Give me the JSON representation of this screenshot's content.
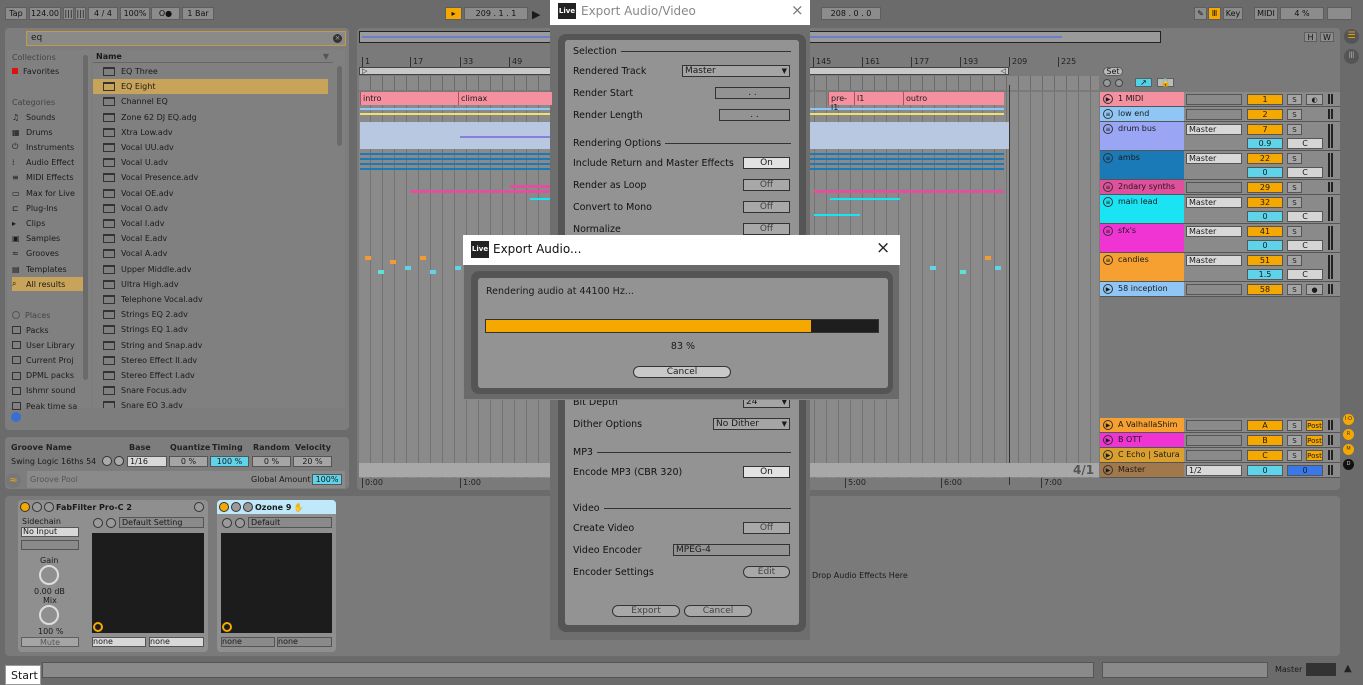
{
  "transport": {
    "tap": "Tap",
    "tempo": "124.00",
    "signature": "4 / 4",
    "zoom": "100%",
    "metronome": "O●",
    "quantize": "1 Bar",
    "position": "209 .  1 .  1",
    "loop_length": "208 .  0 .  0",
    "key": "Key",
    "midi": "MIDI",
    "cpu": "4 %"
  },
  "browser": {
    "search_value": "eq",
    "collections_title": "Collections",
    "favorites": "Favorites",
    "categories_title": "Categories",
    "categories": [
      "Sounds",
      "Drums",
      "Instruments",
      "Audio Effect",
      "MIDI Effects",
      "Max for Live",
      "Plug-Ins",
      "Clips",
      "Samples",
      "Grooves",
      "Templates",
      "All results"
    ],
    "places_title": "Places",
    "places": [
      "Packs",
      "User Library",
      "Current Proj",
      "DPML packs",
      "Ishmr sound",
      "Peak time sa"
    ],
    "name_header": "Name",
    "files": [
      "EQ Three",
      "EQ Eight",
      "Channel EQ",
      "Zone 62 DJ EQ.adg",
      "Xtra Low.adv",
      "Vocal UU.adv",
      "Vocal U.adv",
      "Vocal Presence.adv",
      "Vocal OE.adv",
      "Vocal O.adv",
      "Vocal I.adv",
      "Vocal E.adv",
      "Vocal A.adv",
      "Upper Middle.adv",
      "Ultra High.adv",
      "Telephone Vocal.adv",
      "Strings EQ 2.adv",
      "Strings EQ 1.adv",
      "String and Snap.adv",
      "Stereo Effect II.adv",
      "Stereo Effect I.adv",
      "Snare Focus.adv",
      "Snare EQ 3.adv"
    ]
  },
  "groove": {
    "headers": {
      "name": "Groove Name",
      "base": "Base",
      "quantize": "Quantize",
      "timing": "Timing",
      "random": "Random",
      "velocity": "Velocity"
    },
    "row": {
      "name": "Swing Logic 16ths 54",
      "base": "1/16",
      "quantize": "0 %",
      "timing": "100 %",
      "random": "0 %",
      "velocity": "20 %"
    },
    "pool": "Groove Pool",
    "global_label": "Global Amount",
    "global_value": "100%"
  },
  "ruler": {
    "bars": [
      "1",
      "17",
      "33",
      "49",
      "145",
      "161",
      "177",
      "193",
      "209",
      "225"
    ],
    "times": [
      "0:00",
      "1:00",
      "5:00",
      "6:00",
      "7:00"
    ],
    "time_sig": "4/1"
  },
  "locators": [
    "intro",
    "climax",
    "pre-l1",
    "l1",
    "outro"
  ],
  "arrangement": {
    "set_label": "Set",
    "h": "H",
    "w": "W"
  },
  "tracks": [
    {
      "name": "1 MIDI",
      "color": "#f4909f",
      "num": "1",
      "icon": "play",
      "rows": 1,
      "extra": "◐"
    },
    {
      "name": "low end",
      "color": "#8fc6f5",
      "num": "2",
      "icon": "group",
      "rows": 1
    },
    {
      "name": "drum bus",
      "color": "#9aa6f4",
      "num": "7",
      "icon": "group",
      "rows": 2,
      "route": "Master",
      "vol": "0.9",
      "pan": "C"
    },
    {
      "name": "ambs",
      "color": "#1a7ab8",
      "num": "22",
      "icon": "group",
      "rows": 2,
      "route": "Master",
      "vol": "0",
      "pan": "C"
    },
    {
      "name": "2ndary synths",
      "color": "#e0509c",
      "num": "29",
      "icon": "group",
      "rows": 1
    },
    {
      "name": "main lead",
      "color": "#1ae4f4",
      "num": "32",
      "icon": "group",
      "rows": 2,
      "route": "Master",
      "vol": "0",
      "pan": "C"
    },
    {
      "name": "sfx's",
      "color": "#f034d4",
      "num": "41",
      "icon": "group",
      "rows": 2,
      "route": "Master",
      "vol": "0",
      "pan": "C"
    },
    {
      "name": "candies",
      "color": "#f5a030",
      "num": "51",
      "icon": "group",
      "rows": 2,
      "route": "Master",
      "vol": "1.5",
      "pan": "C"
    },
    {
      "name": "58 inception",
      "color": "#8fc6f5",
      "num": "58",
      "icon": "play",
      "rows": 1,
      "extra": "●"
    }
  ],
  "returns": [
    {
      "name": "A ValhallaShim",
      "color": "#f5a030",
      "num": "A",
      "extra": "Post"
    },
    {
      "name": "B OTT",
      "color": "#f034d4",
      "num": "B",
      "extra": "Post"
    },
    {
      "name": "C Echo | Satura",
      "color": "#d9a030",
      "num": "C",
      "extra": "Post"
    }
  ],
  "master": {
    "name": "Master",
    "color": "#a0784c",
    "route": "1/2",
    "vol": "0",
    "pan": "0"
  },
  "side_buttons": [
    "I·O",
    "R",
    "M",
    "D"
  ],
  "devices": [
    {
      "title": "FabFilter Pro-C 2",
      "preset": "Default Setting",
      "sidechain_label": "Sidechain",
      "sidechain": "No Input",
      "gain_label": "Gain",
      "gain": "0.00 dB",
      "mix_label": "Mix",
      "mix": "100 %",
      "mute": "Mute",
      "out1": "none",
      "out2": "none"
    },
    {
      "title": "Ozone 9",
      "preset": "Default",
      "out1": "none",
      "out2": "none"
    }
  ],
  "drop_hint": "Drop Audio Effects Here",
  "status": {
    "start": "Start",
    "master": "Master"
  },
  "export_dialog": {
    "title": "Export Audio/Video",
    "selection": "Selection",
    "rendered_track_label": "Rendered Track",
    "rendered_track": "Master",
    "render_start_label": "Render Start",
    "render_start": ".   .",
    "render_length_label": "Render Length",
    "render_length": ".   .",
    "rendering_options": "Rendering Options",
    "include_label": "Include Return and Master Effects",
    "include": "On",
    "loop_label": "Render as Loop",
    "loop": "Off",
    "mono_label": "Convert to Mono",
    "mono": "Off",
    "normalize_label": "Normalize",
    "normalize": "Off",
    "bit_depth_label": "Bit Depth",
    "bit_depth": "24",
    "dither_label": "Dither Options",
    "dither": "No Dither",
    "mp3": "MP3",
    "encode_label": "Encode MP3 (CBR 320)",
    "encode": "On",
    "video": "Video",
    "create_video_label": "Create Video",
    "create_video": "Off",
    "encoder_label": "Video Encoder",
    "encoder": "MPEG-4",
    "encoder_settings_label": "Encoder Settings",
    "edit": "Edit",
    "export": "Export",
    "cancel": "Cancel"
  },
  "progress_dialog": {
    "title": "Export Audio...",
    "logo": "Live",
    "message": "Rendering audio at 44100 Hz...",
    "percent": 83,
    "percent_label": "83 %",
    "cancel": "Cancel"
  }
}
